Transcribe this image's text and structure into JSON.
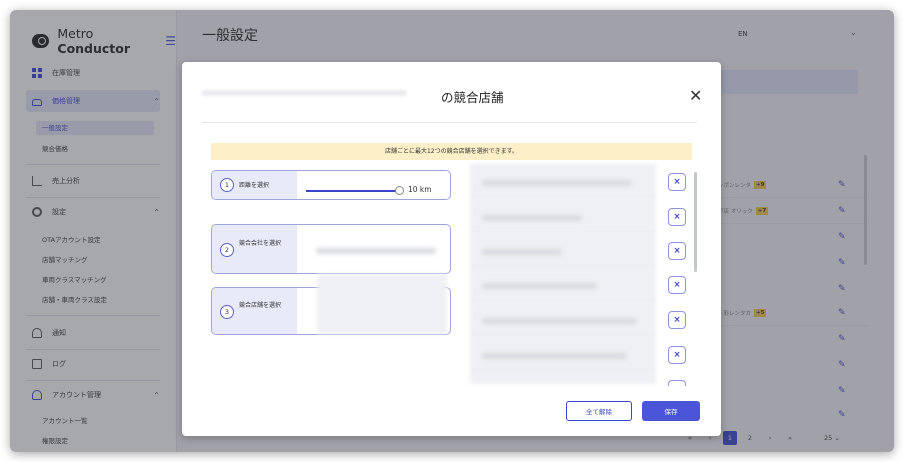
{
  "app": {
    "brand_prefix": "Metro ",
    "brand_bold": "Conductor"
  },
  "sidebar": {
    "inventory": "在庫管理",
    "pricing": "価格管理",
    "pricing_sub": [
      "一般設定",
      "競合価格"
    ],
    "sales": "売上分析",
    "settings": "設定",
    "settings_sub": [
      "OTAアカウント設定",
      "店舗マッチング",
      "車両クラスマッチング",
      "店舗・車両クラス設定"
    ],
    "notifications": "通知",
    "logs": "ログ",
    "accounts": "アカウント管理",
    "accounts_sub": [
      "アカウント一覧",
      "権限設定"
    ]
  },
  "header": {
    "title": "一般設定",
    "language": "EN"
  },
  "background": {
    "row1_text": "ッポンレンタ",
    "row1_tag": "+9",
    "row2_text": "宇店 オリック",
    "row2_tag": "+7",
    "row3_text": "・彩レンタカ",
    "row3_tag": "+5"
  },
  "pagination": {
    "first": "«",
    "prev": "‹",
    "current": "1",
    "next_page": "2",
    "next": "›",
    "last": "»",
    "page_size": "25"
  },
  "modal": {
    "title": "の競合店舗",
    "close": "✕",
    "notice": "店舗ごとに最大12つの競合店舗を選択できます。",
    "steps": [
      {
        "num": "1",
        "label": "距離を選択"
      },
      {
        "num": "2",
        "label": "競合会社を選択"
      },
      {
        "num": "3",
        "label": "競合店舗を選択"
      }
    ],
    "distance_value": "10 km",
    "remove_label": "×",
    "clear_all": "全て解除",
    "save": "保存"
  },
  "colors": {
    "accent": "#4a55d8",
    "notice_bg": "#fdf0c8",
    "tag": "#f2c84b"
  }
}
